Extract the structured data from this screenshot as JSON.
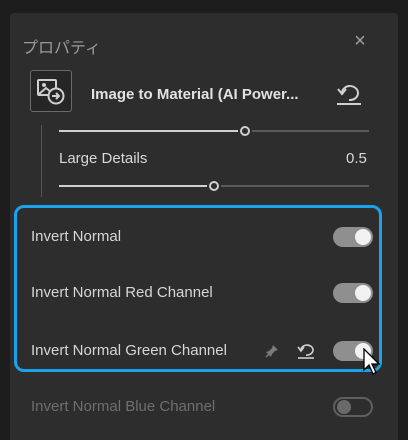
{
  "panel": {
    "title": "プロパティ",
    "close_glyph": "×"
  },
  "header": {
    "title": "Image to Material (AI Power...",
    "icon": "image-to-material-icon"
  },
  "slider_above": {
    "value_fraction": 0.6
  },
  "param": {
    "label": "Large Details",
    "value": "0.5",
    "value_fraction": 0.5
  },
  "rows": [
    {
      "label": "Invert Normal",
      "state": "on"
    },
    {
      "label": "Invert Normal Red Channel",
      "state": "on"
    },
    {
      "label": "Invert Normal Green Channel",
      "state": "on"
    },
    {
      "label": "Invert Normal Blue Channel",
      "state": "off"
    }
  ],
  "colors": {
    "panel_bg": "#2d2d2d",
    "highlight": "#1aa3e8",
    "toggle_on": "#8f8f8f"
  }
}
